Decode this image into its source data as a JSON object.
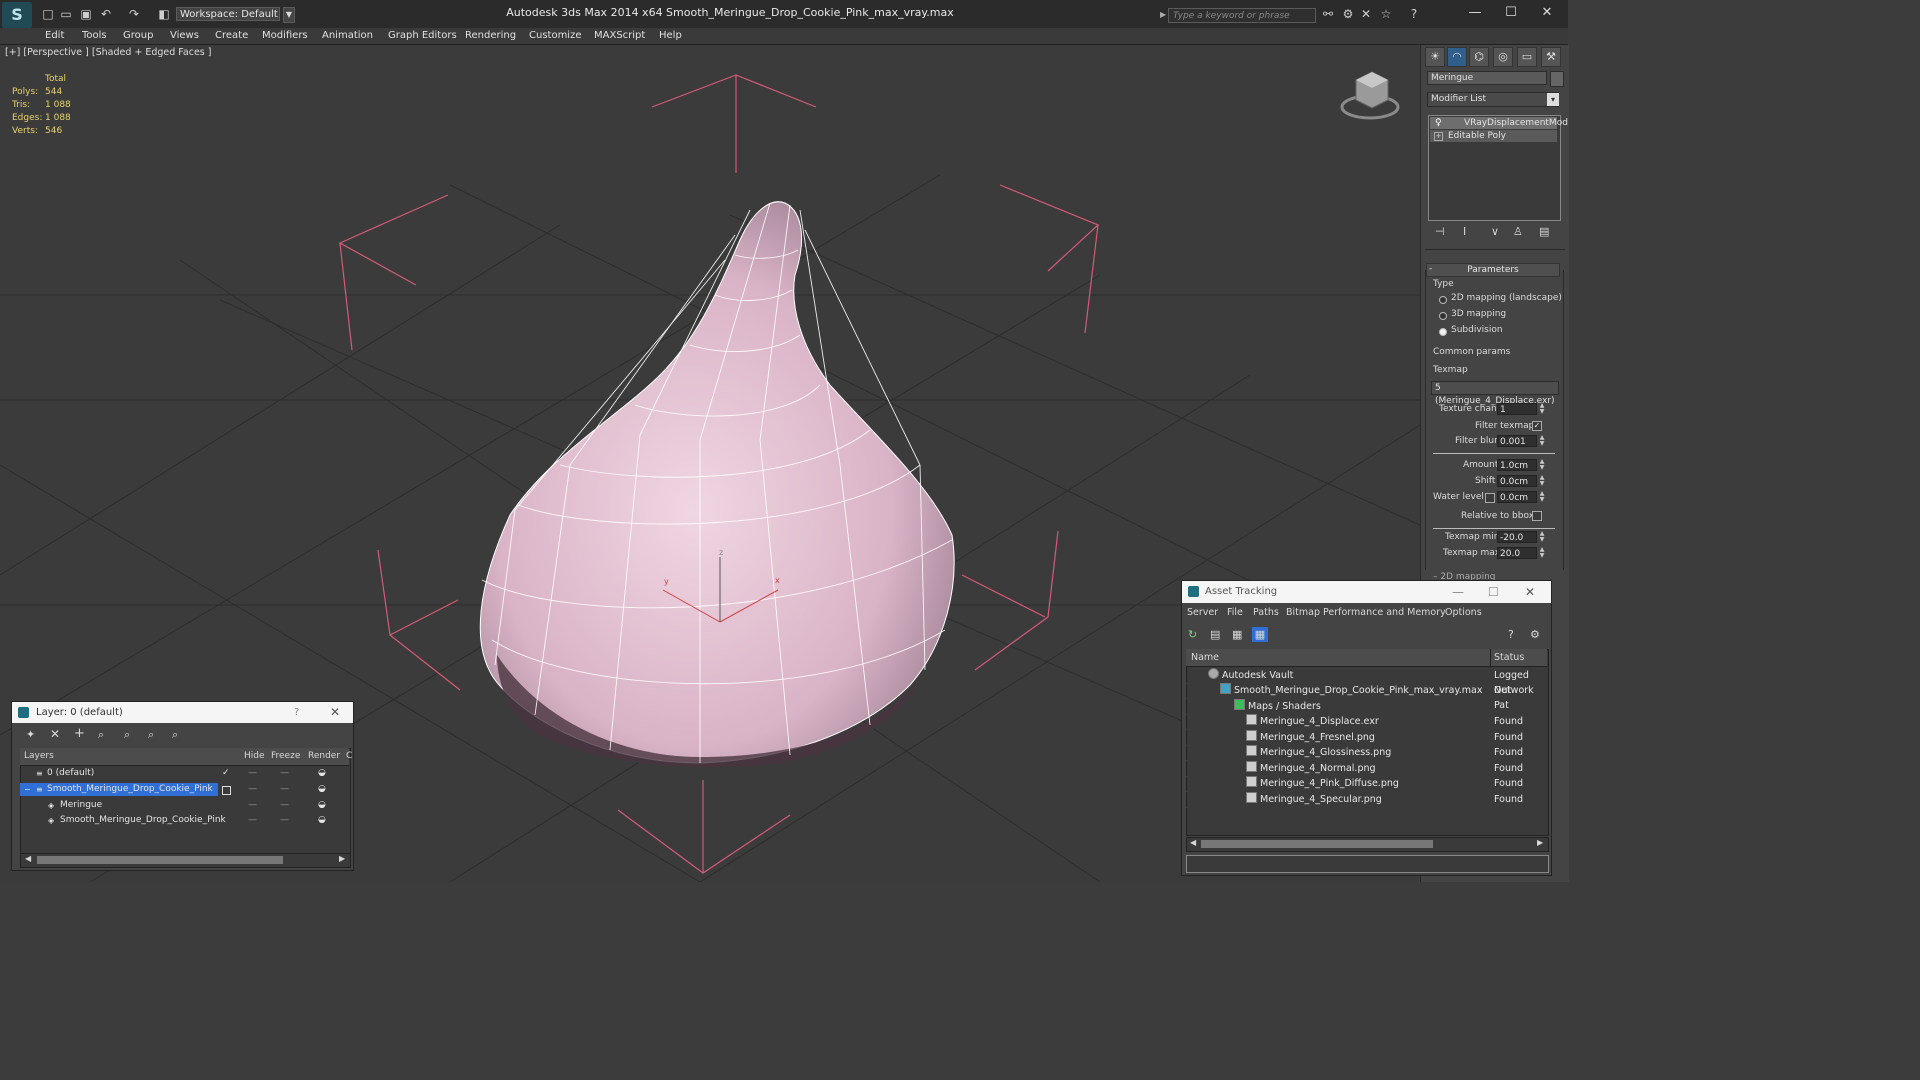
{
  "app": {
    "title": "Autodesk 3ds Max  2014 x64      Smooth_Meringue_Drop_Cookie_Pink_max_vray.max",
    "workspace": "Workspace: Default",
    "search_placeholder": "Type a keyword or phrase",
    "logo": "S"
  },
  "menu": [
    "Edit",
    "Tools",
    "Group",
    "Views",
    "Create",
    "Modifiers",
    "Animation",
    "Graph Editors",
    "Rendering",
    "Customize",
    "MAXScript",
    "Help"
  ],
  "viewport": {
    "label": "[+] [Perspective ] [Shaded + Edged Faces ]",
    "stats": {
      "header": "Total",
      "rows": [
        {
          "label": "Polys:",
          "value": "544"
        },
        {
          "label": "Tris:",
          "value": "1 088"
        },
        {
          "label": "Edges:",
          "value": "1 088"
        },
        {
          "label": "Verts:",
          "value": "546"
        }
      ]
    },
    "gizmo": {
      "x": "x",
      "y": "y",
      "z": "z"
    }
  },
  "command_panel": {
    "object_name": "Meringue",
    "modifier_list": "Modifier List",
    "stack": [
      "VRayDisplacementMod",
      "Editable Poly"
    ],
    "params_header": "Parameters",
    "type_label": "Type",
    "type_options": [
      {
        "label": "2D mapping (landscape)",
        "selected": false
      },
      {
        "label": "3D mapping",
        "selected": false
      },
      {
        "label": "Subdivision",
        "selected": true
      }
    ],
    "common_params": "Common params",
    "texmap_label": "Texmap",
    "texmap_value": "5 (Meringue_4_Displace.exr)",
    "texture_chan_label": "Texture chan",
    "texture_chan_value": "1",
    "filter_texmap_label": "Filter texmap",
    "filter_blur_label": "Filter blur",
    "filter_blur_value": "0.001",
    "amount_label": "Amount",
    "amount_value": "1.0cm",
    "shift_label": "Shift",
    "shift_value": "0.0cm",
    "water_level_label": "Water level",
    "water_level_value": "0.0cm",
    "relative_bbox_label": "Relative to bbox",
    "texmap_min_label": "Texmap min",
    "texmap_min_value": "-20.0",
    "texmap_max_label": "Texmap max",
    "texmap_max_value": "20.0",
    "cut_label": "2D mapping"
  },
  "layer_dialog": {
    "title": "Layer: 0 (default)",
    "help": "?",
    "columns": [
      "Layers",
      "Hide",
      "Freeze",
      "Render",
      "C"
    ],
    "rows": [
      {
        "name": "0 (default)",
        "indent": 1,
        "selected": false
      },
      {
        "name": "Smooth_Meringue_Drop_Cookie_Pink",
        "indent": 1,
        "selected": true
      },
      {
        "name": "Meringue",
        "indent": 2,
        "selected": false
      },
      {
        "name": "Smooth_Meringue_Drop_Cookie_Pink",
        "indent": 2,
        "selected": false
      }
    ]
  },
  "asset_dialog": {
    "title": "Asset Tracking",
    "menu": [
      "Server",
      "File",
      "Paths",
      "Bitmap Performance and Memory",
      "Options"
    ],
    "columns": [
      "Name",
      "Status"
    ],
    "rows": [
      {
        "name": "Autodesk Vault",
        "status": "Logged Out",
        "indent": 0
      },
      {
        "name": "Smooth_Meringue_Drop_Cookie_Pink_max_vray.max",
        "status": "Network Pat",
        "indent": 1
      },
      {
        "name": "Maps / Shaders",
        "status": "",
        "indent": 2
      },
      {
        "name": "Meringue_4_Displace.exr",
        "status": "Found",
        "indent": 3
      },
      {
        "name": "Meringue_4_Fresnel.png",
        "status": "Found",
        "indent": 3
      },
      {
        "name": "Meringue_4_Glossiness.png",
        "status": "Found",
        "indent": 3
      },
      {
        "name": "Meringue_4_Normal.png",
        "status": "Found",
        "indent": 3
      },
      {
        "name": "Meringue_4_Pink_Diffuse.png",
        "status": "Found",
        "indent": 3
      },
      {
        "name": "Meringue_4_Specular.png",
        "status": "Found",
        "indent": 3
      }
    ]
  },
  "colors": {
    "accent": "#2f6fd6",
    "stats": "#e7d36a",
    "mesh": "#e9c7d6",
    "bbox": "#d45a7a"
  }
}
